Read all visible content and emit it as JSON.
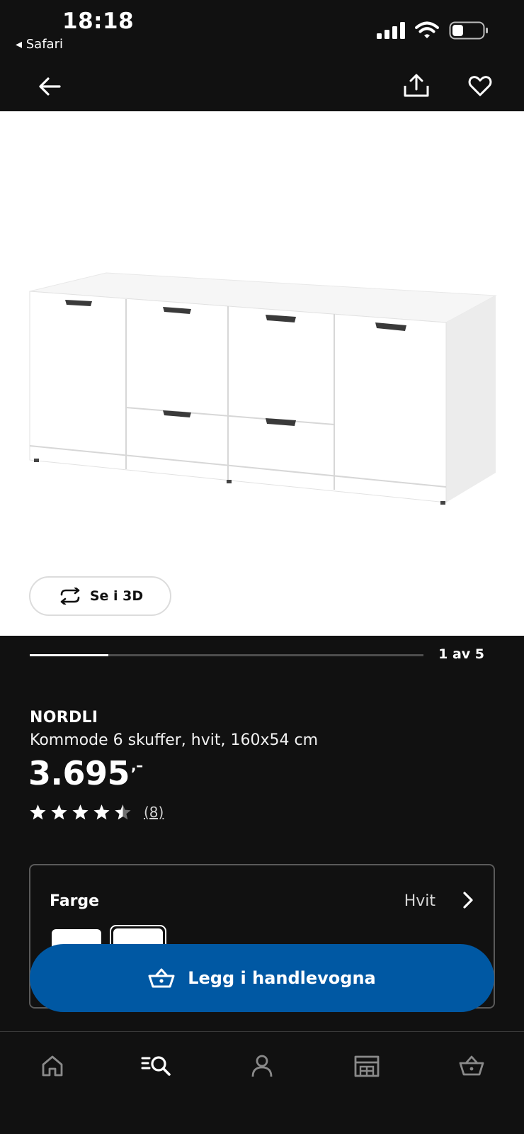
{
  "status_bar": {
    "time": "18:18",
    "back_app": "◂ Safari"
  },
  "top_bar": {
    "back_icon": "arrow-left-icon",
    "share_icon": "share-icon",
    "favorite_icon": "heart-icon"
  },
  "gallery": {
    "see_3d_label": "Se i 3D",
    "current_image": 1,
    "total_images": 5,
    "page_indicator": "1 av 5",
    "progress_fraction": 0.2
  },
  "product": {
    "brand": "NORDLI",
    "description": "Kommode 6 skuffer, hvit, 160x54 cm",
    "price": "3.695",
    "price_suffix": ",–",
    "rating": 4.5,
    "rating_max": 5,
    "review_count": "(8)"
  },
  "color_selector": {
    "label": "Farge",
    "value": "Hvit",
    "selected_index": 1
  },
  "cta": {
    "label": "Legg i handlevogna",
    "color": "#0058a3"
  },
  "bottom_nav": {
    "items": [
      "home-icon",
      "search-icon",
      "profile-icon",
      "store-icon",
      "cart-icon"
    ]
  },
  "colors": {
    "background": "#111111",
    "accent_blue": "#0058a3"
  }
}
